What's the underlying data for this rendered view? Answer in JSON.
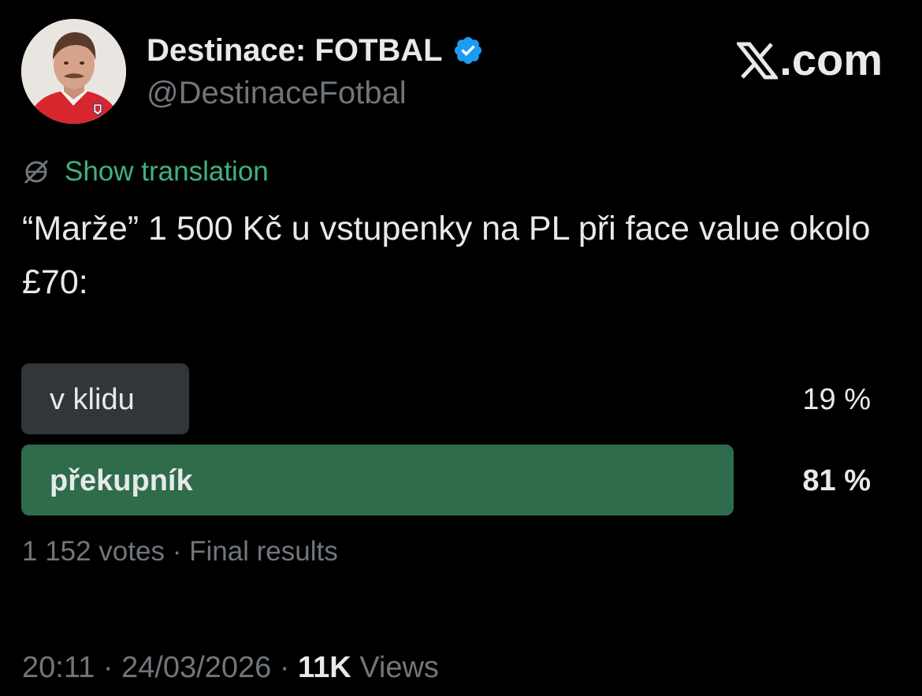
{
  "author": {
    "display_name": "Destinace: FOTBAL",
    "handle": "@DestinaceFotbal",
    "avatar_icon": "person-avatar",
    "verified_icon": "verified-badge-icon",
    "verified_color": "#1d9bf0"
  },
  "brand": {
    "logo_icon": "x-logo-icon",
    "suffix": ".com"
  },
  "translation": {
    "icon": "globe-slash-icon",
    "label": "Show translation",
    "color": "#3fb27f"
  },
  "tweet": {
    "text": "“Marže” 1 500 Kč u vstupenky na PL při face value okolo £70:"
  },
  "poll": {
    "options": [
      {
        "label": "v klidu",
        "percent_text": "19 %",
        "percent": 19,
        "winner": false,
        "bar_color": "#333639"
      },
      {
        "label": "překupník",
        "percent_text": "81 %",
        "percent": 81,
        "winner": true,
        "bar_color": "#2e6c4b"
      }
    ],
    "meta": "1 152 votes · Final results"
  },
  "footer": {
    "time": "20:11",
    "date": "24/03/2026",
    "views_count": "11K",
    "views_label": "Views"
  }
}
